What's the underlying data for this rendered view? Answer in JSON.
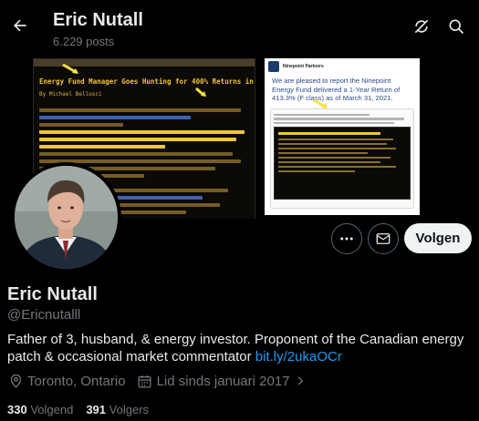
{
  "header": {
    "title": "Eric Nutall",
    "post_count": "6.229 posts"
  },
  "banner": {
    "left_headline": "Energy Fund Manager Goes Hunting for 400% Returns in Ugly Market",
    "left_byline": "By Michael Bellusci",
    "right_company": "Ninepoint Partners",
    "right_text": "We are pleased to report the Ninepoint Energy Fund delivered a 1-Year Return of 413.3% (F class) as of March 31, 2021."
  },
  "actions": {
    "follow_label": "Volgen"
  },
  "profile": {
    "name": "Eric Nutall",
    "handle": "@Ericnutalll",
    "bio": "Father of 3, husband, & energy investor. Proponent of the Canadian energy patch & occasional market commentator ",
    "bio_link": "bit.ly/2ukaOCr",
    "location": "Toronto, Ontario",
    "joined": "Lid sinds januari 2017",
    "following_count": "330",
    "following_label": "Volgend",
    "followers_count": "391",
    "followers_label": "Volgers"
  },
  "colors": {
    "accent": "#1d9bf0",
    "muted": "#71767b",
    "text": "#e7e9ea",
    "background": "#000000"
  },
  "icons": [
    "back-arrow-icon",
    "refresh-off-icon",
    "search-icon",
    "more-icon",
    "mail-icon",
    "location-icon",
    "calendar-icon",
    "chevron-right-icon"
  ]
}
